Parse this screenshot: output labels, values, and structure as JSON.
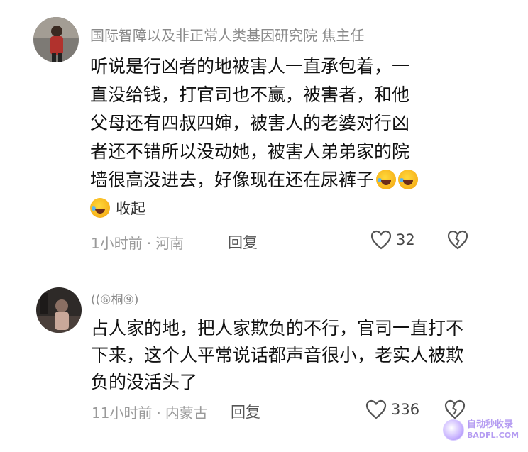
{
  "comments": [
    {
      "username": "国际智障以及非正常人类基因研究院 焦主任",
      "lines": [
        "听说是行凶者的地被害人一直承包着，一",
        "直没给钱，打官司也不赢，被害者，和他",
        "父母还有四叔四婶，被害人的老婆对行凶",
        "者还不错所以没动她，被害人弟弟家的院",
        "墙很高没进去，好像现在还在尿裤子"
      ],
      "collapse_label": "收起",
      "time": "1小时前",
      "location": "河南",
      "reply_label": "回复",
      "likes": "32"
    },
    {
      "username": "((⑥桐⑨)",
      "lines": [
        "占人家的地，把人家欺负的不行，官司一直打不",
        "下来，这个人平常说话都声音很小，老实人被欺",
        "负的没活头了"
      ],
      "time": "11小时前",
      "location": "内蒙古",
      "reply_label": "回复",
      "likes": "336"
    }
  ],
  "meta_separator": "·",
  "icons": {
    "like": "heart-outline-icon",
    "dislike": "broken-heart-icon",
    "emoji": "rolling-laughing-emoji"
  },
  "watermark": {
    "top": "自动秒收录",
    "bottom": "BADFL.COM"
  }
}
